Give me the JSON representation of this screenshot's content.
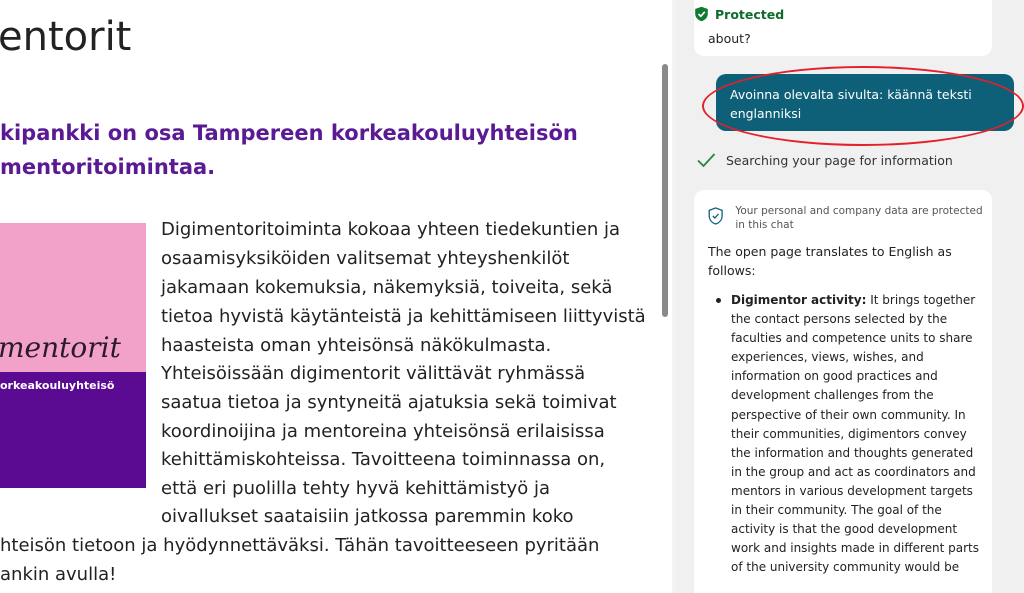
{
  "page": {
    "title": "entorit",
    "intro_lines": [
      "kipankki on osa Tampereen korkeakouluyhteisön",
      "mentoritoimintaa."
    ],
    "logo": {
      "word": "mentorit",
      "subtitle": "orkeakouluyhteisö",
      "top_color": "#f2a2c9",
      "bottom_color": "#5b0a92"
    },
    "body_lines": [
      "Digimentoritoiminta kokoaa yhteen tiedekuntien ja",
      "osaamisyksiköiden valitsemat yhteyshenkilöt",
      "jakamaan kokemuksia, näkemyksiä, toiveita, sekä",
      "tietoa hyvistä käytänteistä ja kehittämiseen liittyvistä",
      "haasteista oman yhteisönsä näkökulmasta.",
      "Yhteisöissään digimentorit välittävät ryhmässä",
      "saatua tietoa ja syntyneitä ajatuksia sekä toimivat",
      "koordinoijina ja mentoreina yhteisönsä erilaisissa",
      "kehittämiskohteissa. Tavoitteena toiminnassa on,",
      "että eri puolilla tehty hyvä kehittämistyö ja",
      "oivallukset saataisiin jatkossa paremmin koko",
      "hteisön tietoon ja hyödynnettäväksi. Tähän tavoitteeseen pyritään",
      "ankin avulla!"
    ]
  },
  "sidebar": {
    "protected_label": "Protected",
    "previous_message_tail": "about?",
    "user_message": "Avoinna olevalta sivulta: käännä teksti\nenglanniksi",
    "status_text": "Searching your page for information",
    "privacy_note": "Your personal and company data are protected in this chat",
    "answer_intro": "The open page translates to English as follows:",
    "answer_bullet_title": "Digimentor activity:",
    "answer_lines": [
      "It brings together",
      "the contact persons selected by the",
      "faculties and competence units to share",
      "experiences, views, wishes, and",
      "information on good practices and",
      "development challenges from the",
      "perspective of their own community. In",
      "their communities, digimentors convey",
      "the information and thoughts generated",
      "in the group and act as coordinators and",
      "mentors in various development targets",
      "in their community. The goal of the",
      "activity is that the good development",
      "work and insights made in different parts",
      "of the university community would be"
    ],
    "colors": {
      "user_bubble": "#0e5f78",
      "protected_green": "#0e6b2c",
      "annotation_red": "#e4202a"
    }
  }
}
